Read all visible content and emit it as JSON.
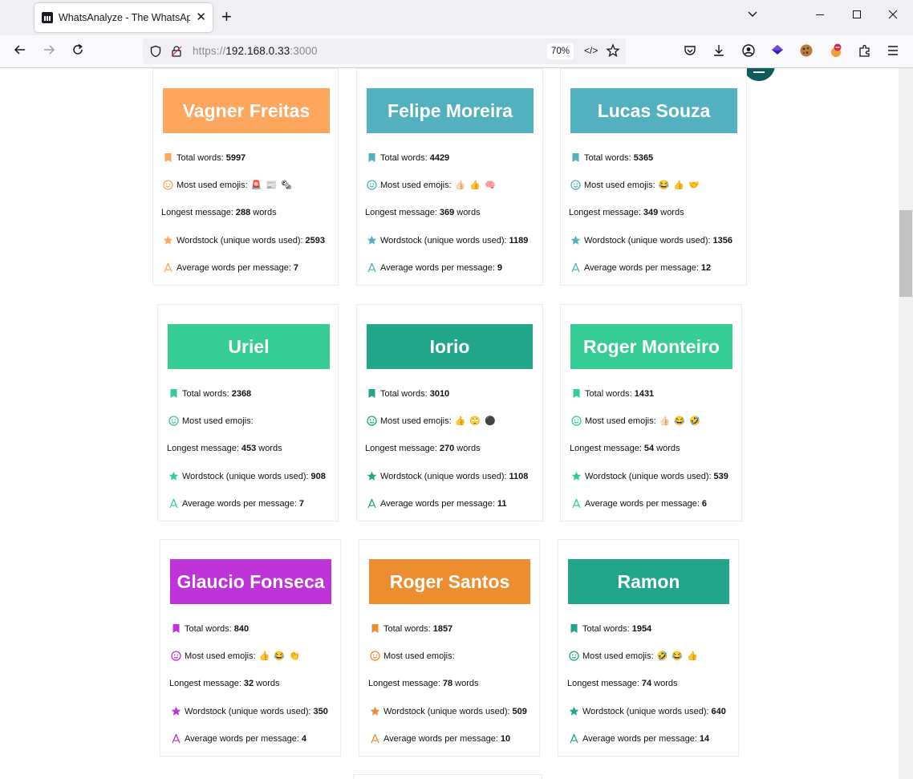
{
  "browser": {
    "tab_title": "WhatsAnalyze - The WhatsApp",
    "url_secure": "https://",
    "url_host": "192.168.0.33",
    "url_port": ":3000",
    "zoom": "70%"
  },
  "labels": {
    "total_words": "Total words:",
    "most_used_emojis": "Most used emojis:",
    "longest_message": "Longest message:",
    "words_suffix": "words",
    "wordstock": "Wordstock (unique words used):",
    "average_words": "Average words per message:"
  },
  "cards": [
    {
      "name": "Vagner Freitas",
      "color": "#fea55e",
      "total_words": "5997",
      "emojis": "🚨 📰 🗞",
      "longest_message": "288",
      "wordstock": "2593",
      "average_words": "7"
    },
    {
      "name": "Felipe Moreira",
      "color": "#53b1bf",
      "total_words": "4429",
      "emojis": "👍🏻 👍 🧠",
      "longest_message": "369",
      "wordstock": "1189",
      "average_words": "9"
    },
    {
      "name": "Lucas Souza",
      "color": "#53b1bf",
      "total_words": "5365",
      "emojis": "😂 👍 🤝",
      "longest_message": "349",
      "wordstock": "1356",
      "average_words": "12"
    },
    {
      "name": "Uriel",
      "color": "#35cd95",
      "total_words": "2368",
      "emojis": "",
      "longest_message": "453",
      "wordstock": "908",
      "average_words": "7"
    },
    {
      "name": "Iorio",
      "color": "#22a68b",
      "total_words": "3010",
      "emojis": "👍 🙄 ⚫",
      "longest_message": "270",
      "wordstock": "1108",
      "average_words": "11"
    },
    {
      "name": "Roger Monteiro",
      "color": "#35cd95",
      "total_words": "1431",
      "emojis": "👍🏻 😂 🤣",
      "longest_message": "54",
      "wordstock": "539",
      "average_words": "6"
    },
    {
      "name": "Glaucio Fonseca",
      "color": "#bf34d9",
      "total_words": "840",
      "emojis": "👍 😂 👏",
      "longest_message": "32",
      "wordstock": "350",
      "average_words": "4"
    },
    {
      "name": "Roger Santos",
      "color": "#ec8e2f",
      "total_words": "1857",
      "emojis": "",
      "longest_message": "78",
      "wordstock": "509",
      "average_words": "10"
    },
    {
      "name": "Ramon",
      "color": "#22a68b",
      "total_words": "1954",
      "emojis": "🤣 😂 👍",
      "longest_message": "74",
      "wordstock": "640",
      "average_words": "14"
    }
  ]
}
